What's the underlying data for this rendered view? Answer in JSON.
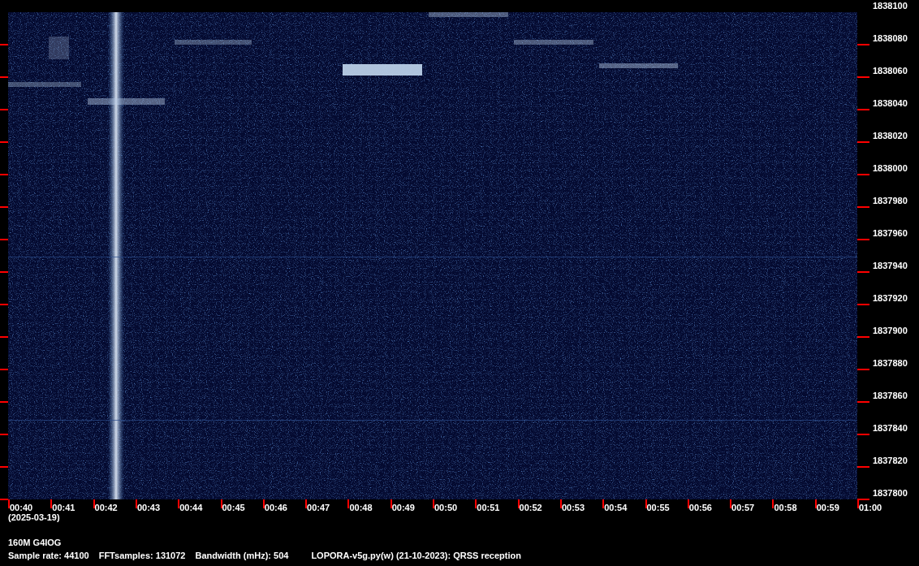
{
  "frequency_axis": {
    "labels": [
      "1838100",
      "1838080",
      "1838060",
      "1838040",
      "1838020",
      "1838000",
      "1837980",
      "1837960",
      "1837940",
      "1837920",
      "1837900",
      "1837880",
      "1837860",
      "1837840",
      "1837820",
      "1837800"
    ]
  },
  "time_axis": {
    "labels": [
      "00:40",
      "00:41",
      "00:42",
      "00:43",
      "00:44",
      "00:45",
      "00:46",
      "00:47",
      "00:48",
      "00:49",
      "00:50",
      "00:51",
      "00:52",
      "00:53",
      "00:54",
      "00:55",
      "00:56",
      "00:57",
      "00:58",
      "00:59",
      "01:00"
    ],
    "date": "(2025-03-19)"
  },
  "station": "160M G4IOG",
  "info": {
    "sample_rate": "Sample rate: 44100",
    "fft_samples": "FFTsamples: 131072",
    "bandwidth": "Bandwidth (mHz): 504",
    "program": "LOPORA-v5g.py(w) (21-10-2023): QRSS reception"
  }
}
